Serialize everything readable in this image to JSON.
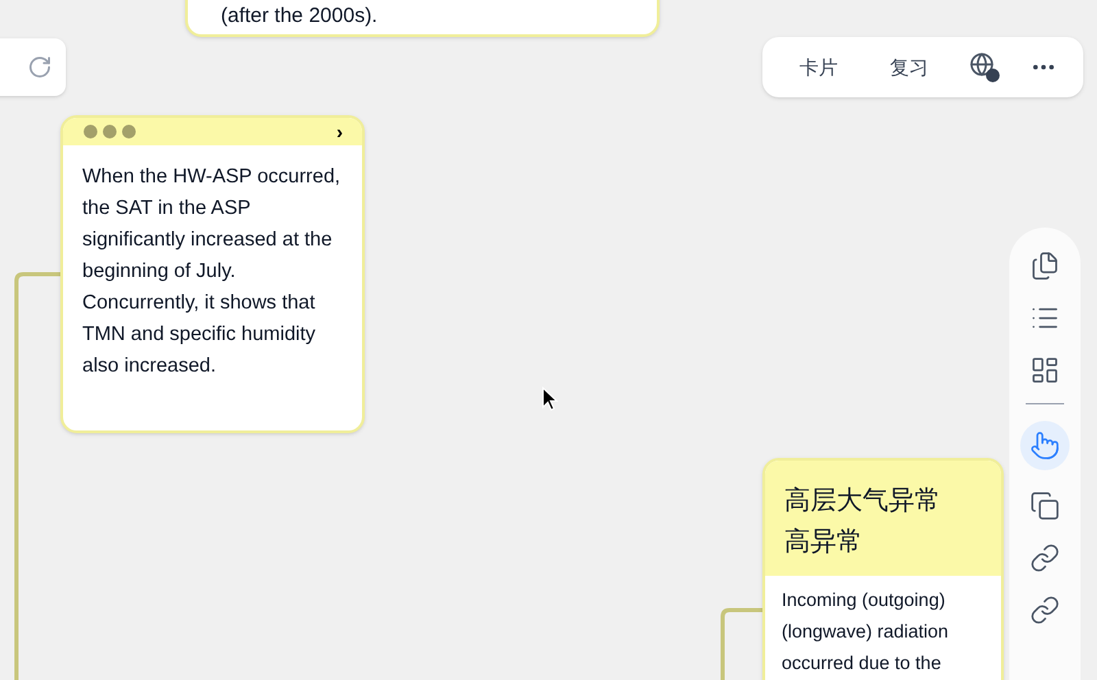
{
  "top_card": {
    "text": "(after the 2000s)."
  },
  "top_bar": {
    "items": [
      {
        "kind": "text",
        "label": "卡片"
      },
      {
        "kind": "text",
        "label": "复习"
      },
      {
        "kind": "web-help"
      },
      {
        "kind": "more"
      }
    ]
  },
  "left_card": {
    "chevron": "›",
    "text": "When the HW-ASP occurred, the SAT in the ASP significantly increased at the beginning of July. Concurrently, it shows that TMN and specific humidity also increased."
  },
  "right_card": {
    "title": "高层大气异常高异常",
    "text": "Incoming (outgoing) (longwave) radiation occurred due to the"
  },
  "side_tools": [
    {
      "kind": "cards",
      "selected": false
    },
    {
      "kind": "list",
      "selected": false
    },
    {
      "kind": "layout",
      "selected": false
    },
    {
      "kind": "divider",
      "selected": false
    },
    {
      "kind": "hand",
      "selected": true
    },
    {
      "kind": "copy",
      "selected": false
    },
    {
      "kind": "link",
      "selected": false
    },
    {
      "kind": "link",
      "selected": false
    }
  ]
}
